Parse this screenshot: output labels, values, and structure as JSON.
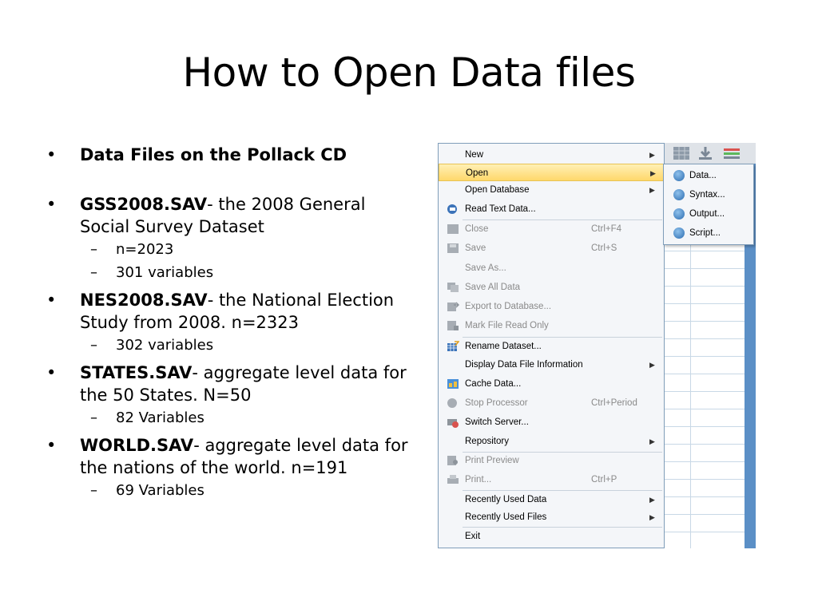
{
  "slide": {
    "title": "How to Open Data files",
    "bullets": [
      {
        "bold": "Data Files on the Pollack CD",
        "text": ""
      },
      {
        "bold": "GSS2008.SAV",
        "text": "- the 2008 General Social Survey Dataset",
        "subs": [
          "n=2023",
          "301 variables"
        ]
      },
      {
        "bold": "NES2008.SAV",
        "text": "- the National Election Study from 2008. n=2323",
        "subs": [
          "302 variables"
        ]
      },
      {
        "bold": "STATES.SAV",
        "text": "- aggregate level data for the 50 States. N=50",
        "subs": [
          "82 Variables"
        ]
      },
      {
        "bold": "WORLD.SAV",
        "text": "- aggregate level data for the nations of the world. n=191",
        "subs": [
          "69 Variables"
        ]
      }
    ]
  },
  "menu": {
    "items": [
      {
        "label": "New",
        "arrow": "▶"
      },
      {
        "label": "Open",
        "arrow": "▶"
      },
      {
        "label": "Open Database",
        "arrow": "▶"
      },
      {
        "label": "Read Text Data..."
      },
      {
        "label": "Close",
        "shortcut": "Ctrl+F4"
      },
      {
        "label": "Save",
        "shortcut": "Ctrl+S"
      },
      {
        "label": "Save As..."
      },
      {
        "label": "Save All Data"
      },
      {
        "label": "Export to Database..."
      },
      {
        "label": "Mark File Read Only"
      },
      {
        "label": "Rename Dataset..."
      },
      {
        "label": "Display Data File Information",
        "arrow": "▶"
      },
      {
        "label": "Cache Data..."
      },
      {
        "label": "Stop Processor",
        "shortcut": "Ctrl+Period"
      },
      {
        "label": "Switch Server..."
      },
      {
        "label": "Repository",
        "arrow": "▶"
      },
      {
        "label": "Print Preview"
      },
      {
        "label": "Print...",
        "shortcut": "Ctrl+P"
      },
      {
        "label": "Recently Used Data",
        "arrow": "▶"
      },
      {
        "label": "Recently Used Files",
        "arrow": "▶"
      },
      {
        "label": "Exit"
      }
    ]
  },
  "submenu": {
    "items": [
      {
        "label": "Data..."
      },
      {
        "label": "Syntax..."
      },
      {
        "label": "Output..."
      },
      {
        "label": "Script..."
      }
    ]
  },
  "colors": {
    "highlight": "#ffd86b",
    "menu_bg": "#f4f6f9",
    "menu_border": "#7f9db9",
    "disabled_text": "#8a8a8a"
  }
}
